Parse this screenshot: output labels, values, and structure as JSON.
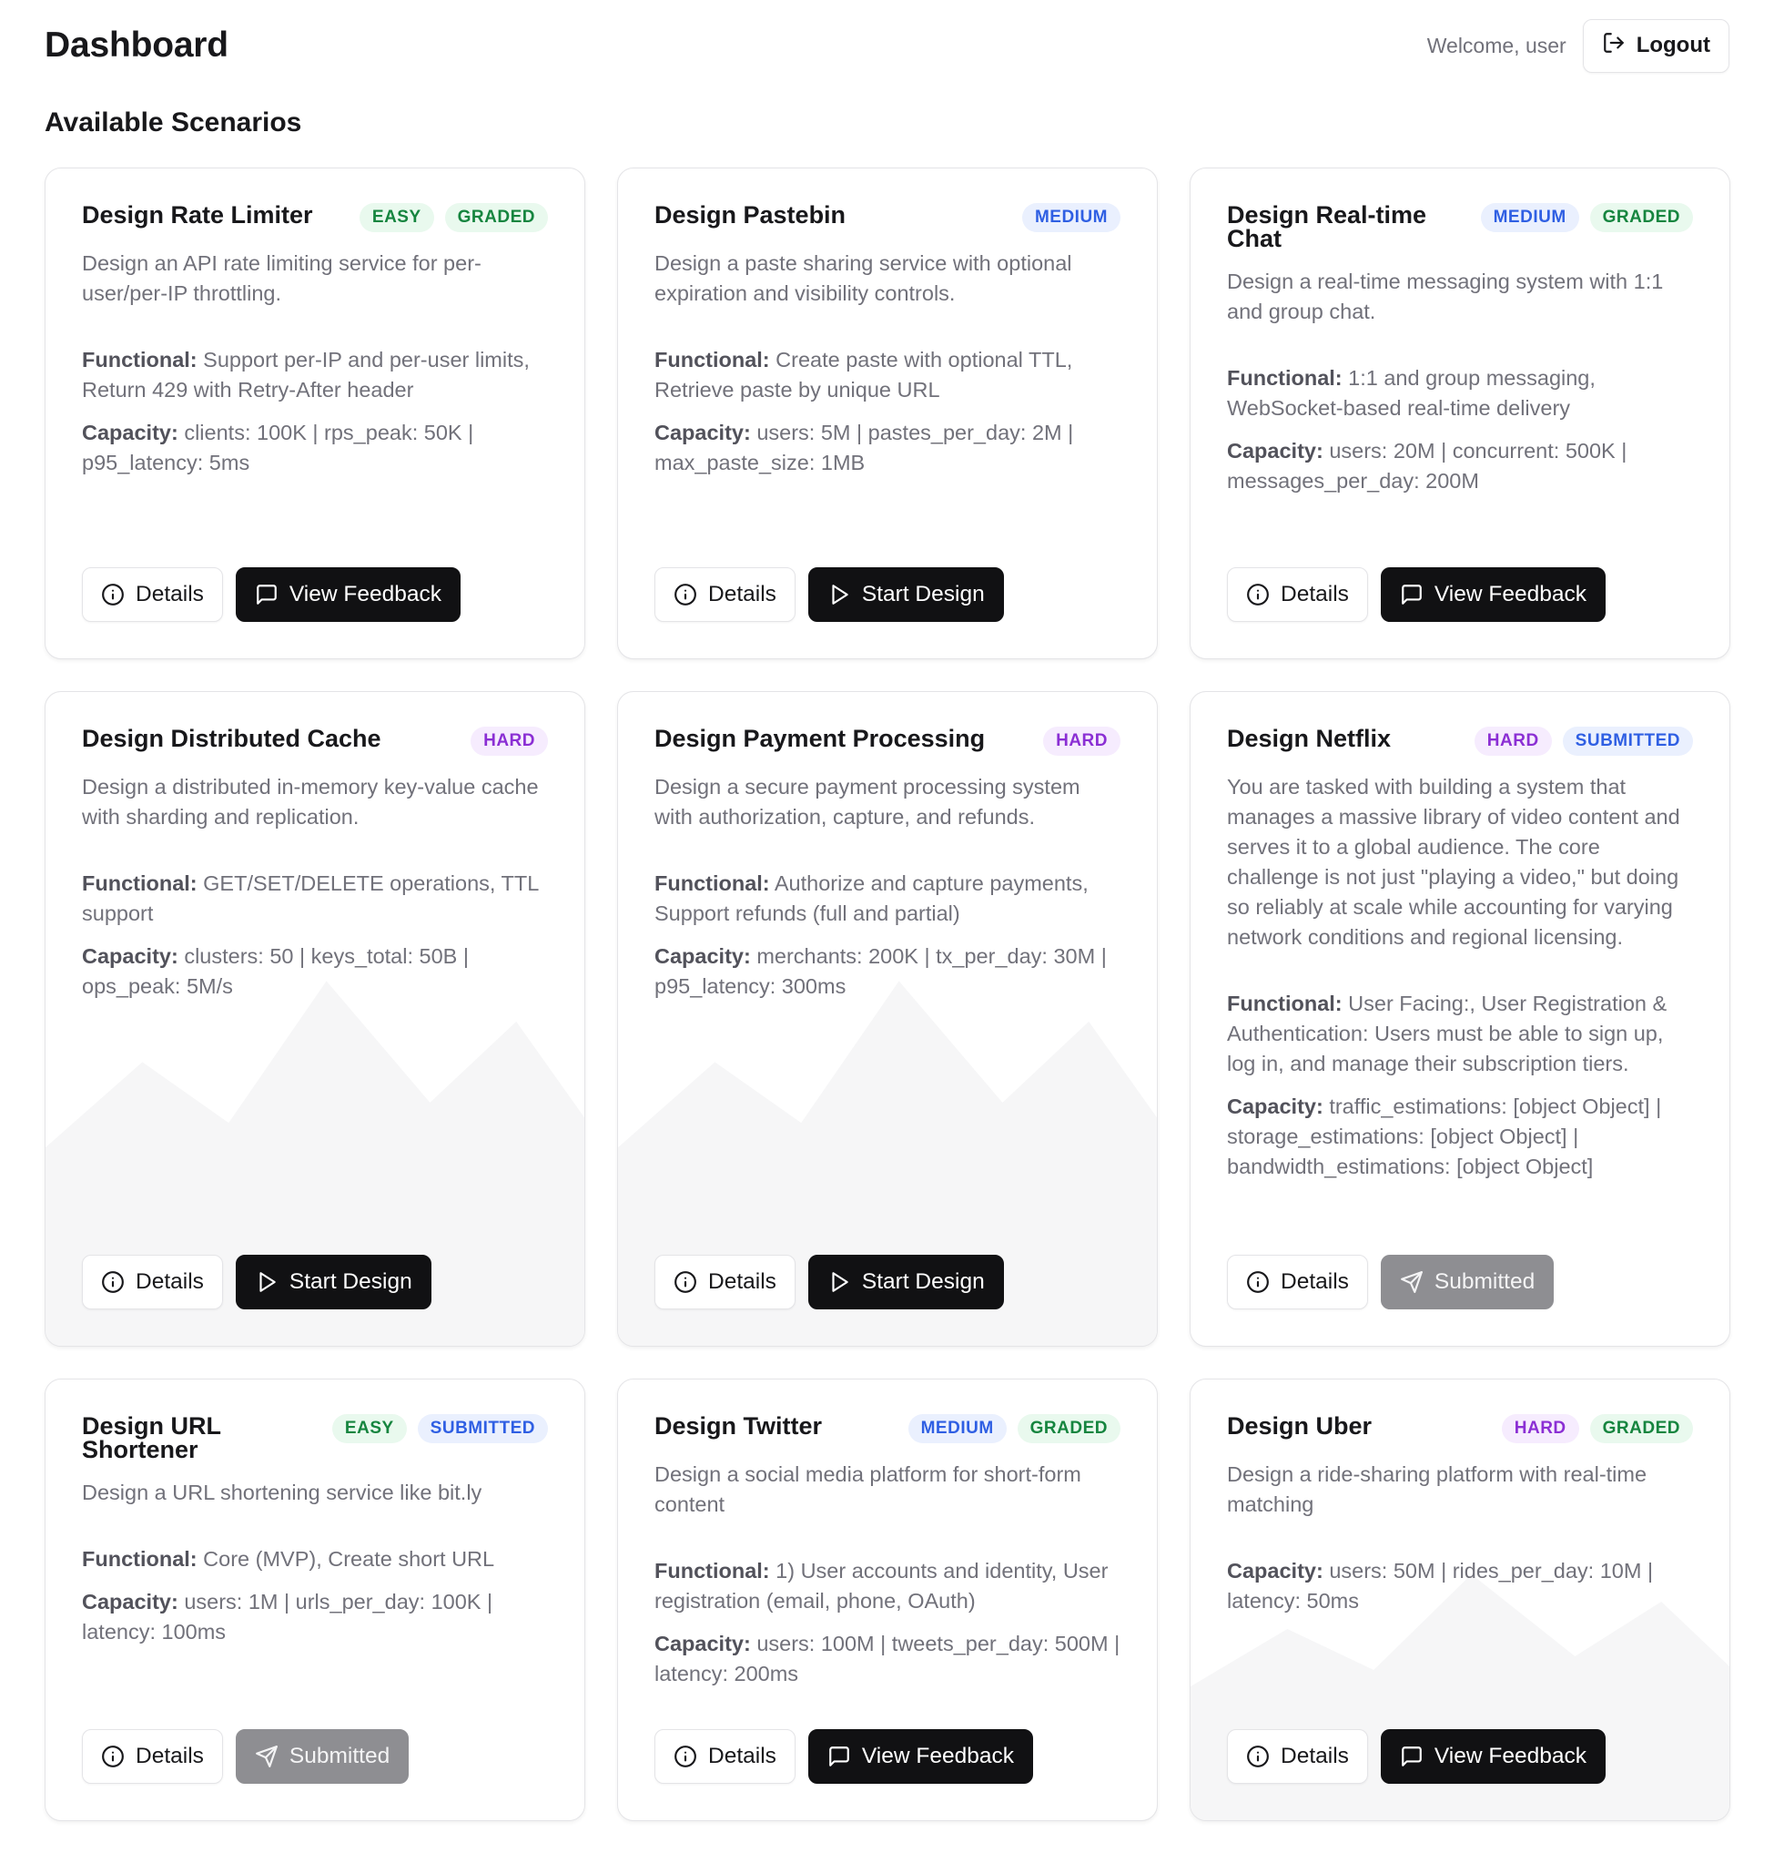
{
  "header": {
    "title": "Dashboard",
    "welcome": "Welcome, user",
    "logout_label": "Logout"
  },
  "section_title": "Available Scenarios",
  "labels": {
    "functional": "Functional:",
    "capacity": "Capacity:",
    "details": "Details",
    "view_feedback": "View Feedback",
    "start_design": "Start Design",
    "submitted": "Submitted"
  },
  "cards": [
    {
      "title": "Design Rate Limiter",
      "badges": [
        "EASY",
        "GRADED"
      ],
      "description": "Design an API rate limiting service for per-user/per-IP throttling.",
      "functional": "Support per-IP and per-user limits, Return 429 with Retry-After header",
      "capacity": "clients: 100K | rps_peak: 50K | p95_latency: 5ms",
      "action": "view_feedback"
    },
    {
      "title": "Design Pastebin",
      "badges": [
        "MEDIUM"
      ],
      "description": "Design a paste sharing service with optional expiration and visibility controls.",
      "functional": "Create paste with optional TTL, Retrieve paste by unique URL",
      "capacity": "users: 5M | pastes_per_day: 2M | max_paste_size: 1MB",
      "action": "start_design"
    },
    {
      "title": "Design Real-time Chat",
      "badges": [
        "MEDIUM",
        "GRADED"
      ],
      "description": "Design a real-time messaging system with 1:1 and group chat.",
      "functional": "1:1 and group messaging, WebSocket-based real-time delivery",
      "capacity": "users: 20M | concurrent: 500K | messages_per_day: 200M",
      "action": "view_feedback"
    },
    {
      "title": "Design Distributed Cache",
      "badges": [
        "HARD"
      ],
      "description": "Design a distributed in-memory key-value cache with sharding and replication.",
      "functional": "GET/SET/DELETE operations, TTL support",
      "capacity": "clusters: 50 | keys_total: 50B | ops_peak: 5M/s",
      "action": "start_design"
    },
    {
      "title": "Design Payment Processing",
      "badges": [
        "HARD"
      ],
      "description": "Design a secure payment processing system with authorization, capture, and refunds.",
      "functional": "Authorize and capture payments, Support refunds (full and partial)",
      "capacity": "merchants: 200K | tx_per_day: 30M | p95_latency: 300ms",
      "action": "start_design"
    },
    {
      "title": "Design Netflix",
      "badges": [
        "HARD",
        "SUBMITTED"
      ],
      "description": "You are tasked with building a system that manages a massive library of video content and serves it to a global audience. The core challenge is not just \"playing a video,\" but doing so reliably at scale while accounting for varying network conditions and regional licensing.",
      "functional": "User Facing:, User Registration & Authentication: Users must be able to sign up, log in, and manage their subscription tiers.",
      "capacity": "traffic_estimations: [object Object] | storage_estimations: [object Object] | bandwidth_estimations: [object Object]",
      "action": "submitted"
    },
    {
      "title": "Design URL Shortener",
      "badges": [
        "EASY",
        "SUBMITTED"
      ],
      "description": "Design a URL shortening service like bit.ly",
      "functional": "Core (MVP), Create short URL",
      "capacity": "users: 1M | urls_per_day: 100K | latency: 100ms",
      "action": "submitted"
    },
    {
      "title": "Design Twitter",
      "badges": [
        "MEDIUM",
        "GRADED"
      ],
      "description": "Design a social media platform for short-form content",
      "functional": "1) User accounts and identity, User registration (email, phone, OAuth)",
      "capacity": "users: 100M | tweets_per_day: 500M | latency: 200ms",
      "action": "view_feedback"
    },
    {
      "title": "Design Uber",
      "badges": [
        "HARD",
        "GRADED"
      ],
      "description": "Design a ride-sharing platform with real-time matching",
      "capacity": "users: 50M | rides_per_day: 10M | latency: 50ms",
      "action": "view_feedback"
    }
  ]
}
